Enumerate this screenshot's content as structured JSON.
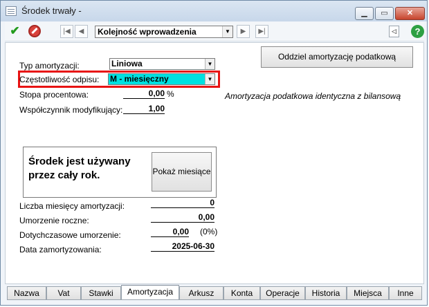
{
  "window": {
    "title": "Środek trwały -",
    "min": "▁",
    "max": "▭",
    "close": "✕"
  },
  "toolbar": {
    "sort_value": "Kolejność wprowadzenia",
    "help": "?"
  },
  "form": {
    "type_label": "Typ amortyzacji:",
    "type_value": "Liniowa",
    "freq_label": "Częstotliwość odpisu:",
    "freq_value": "M - miesięczny",
    "rate_label": "Stopa procentowa:",
    "rate_value": "0,00",
    "rate_unit": "%",
    "coef_label": "Współczynnik modyfikujący:",
    "coef_value": "1,00",
    "tax_button": "Oddziel amortyzację podatkową",
    "tax_note": "Amortyzacja podatkowa identyczna z bilansową",
    "info_line1": "Środek jest używany",
    "info_line2": "przez cały rok.",
    "months_button": "Pokaż miesiące",
    "months_label": "Liczba miesięcy amortyzacji:",
    "months_value": "0",
    "annual_label": "Umorzenie roczne:",
    "annual_value": "0,00",
    "past_label": "Dotychczasowe umorzenie:",
    "past_value": "0,00",
    "past_pct": "(0%)",
    "date_label": "Data zamortyzowania:",
    "date_value": "2025-06-30"
  },
  "tabs": [
    "Nazwa",
    "Vat",
    "Stawki",
    "Amortyzacja",
    "Arkusz",
    "Konta",
    "Operacje",
    "Historia",
    "Miejsca",
    "Inne"
  ],
  "colors": {
    "highlight_border": "#e81313",
    "selected_combo": "#00e0e0"
  }
}
